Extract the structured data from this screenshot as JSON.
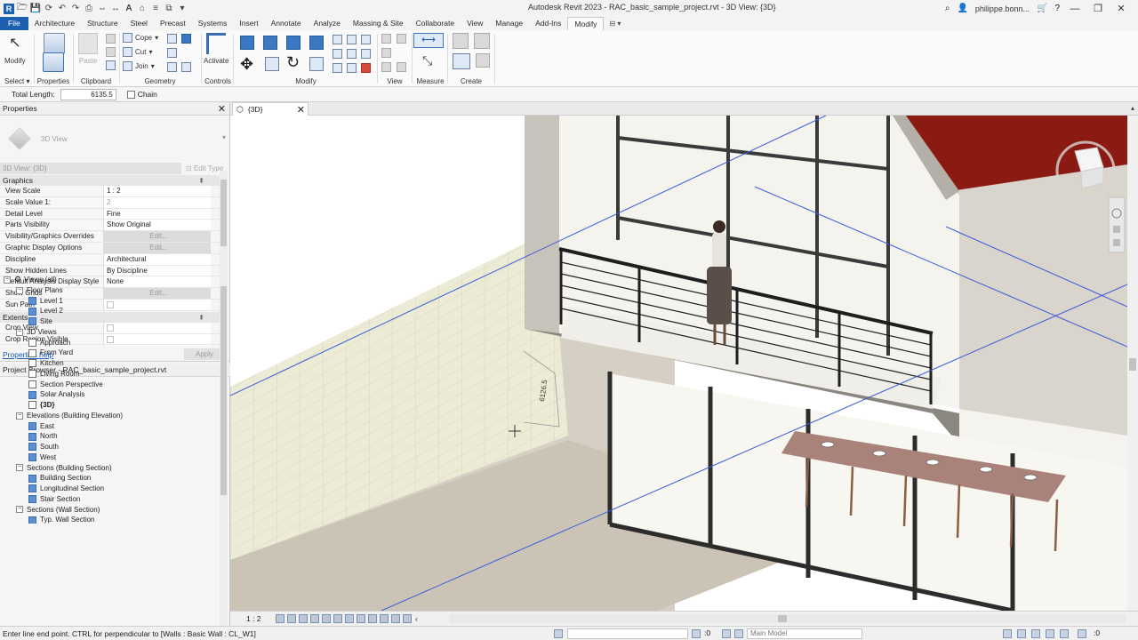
{
  "window": {
    "title": "Autodesk Revit 2023 - RAC_basic_sample_project.rvt - 3D View: {3D}",
    "user": "philippe.bonn...",
    "controls": [
      "—",
      "❐",
      "✕"
    ]
  },
  "ribbon": {
    "tabs": [
      "File",
      "Architecture",
      "Structure",
      "Steel",
      "Precast",
      "Systems",
      "Insert",
      "Annotate",
      "Analyze",
      "Massing & Site",
      "Collaborate",
      "View",
      "Manage",
      "Add-Ins",
      "Modify"
    ],
    "active_tab": "Modify",
    "groups": {
      "select": "Select",
      "select_arrow": "▾",
      "properties": "Properties",
      "clipboard": "Clipboard",
      "geometry": "Geometry",
      "controls": "Controls",
      "modify": "Modify",
      "view": "View",
      "measure": "Measure",
      "create": "Create"
    },
    "buttons": {
      "modify": "Modify",
      "paste": "Paste",
      "cope": "Cope",
      "cut": "Cut",
      "join": "Join",
      "activate": "Activate"
    }
  },
  "options_bar": {
    "total_length_label": "Total Length:",
    "total_length_value": "6135.5",
    "chain_label": "Chain"
  },
  "properties": {
    "title": "Properties",
    "type_name": "3D View",
    "instance_selector": "3D View: {3D}",
    "edit_type": "Edit Type",
    "sections": [
      {
        "name": "Graphics",
        "rows": [
          {
            "name": "View Scale",
            "value": "1 : 2"
          },
          {
            "name": "Scale Value    1:",
            "value": "2",
            "dim": true
          },
          {
            "name": "Detail Level",
            "value": "Fine"
          },
          {
            "name": "Parts Visibility",
            "value": "Show Original"
          },
          {
            "name": "Visibility/Graphics Overrides",
            "value": "Edit...",
            "button": true
          },
          {
            "name": "Graphic Display Options",
            "value": "Edit...",
            "button": true
          },
          {
            "name": "Discipline",
            "value": "Architectural"
          },
          {
            "name": "Show Hidden Lines",
            "value": "By Discipline"
          },
          {
            "name": "Default Analysis Display Style",
            "value": "None"
          },
          {
            "name": "Show Grids",
            "value": "Edit...",
            "button": true
          },
          {
            "name": "Sun Path",
            "value": "",
            "checkbox": true
          }
        ]
      },
      {
        "name": "Extents",
        "rows": [
          {
            "name": "Crop View",
            "value": "",
            "checkbox": true
          },
          {
            "name": "Crop Region Visible",
            "value": "",
            "checkbox": true
          },
          {
            "name": "Annotation Crop",
            "value": "",
            "checkbox": true
          }
        ]
      }
    ],
    "help_link": "Properties help",
    "apply": "Apply"
  },
  "project_browser": {
    "title": "Project Browser - RAC_basic_sample_project.rvt",
    "nodes": [
      {
        "label": "Views (all)",
        "level": 0,
        "type": "root"
      },
      {
        "label": "Floor Plans",
        "level": 1,
        "type": "group"
      },
      {
        "label": "Level 1",
        "level": 2,
        "type": "view",
        "sel": true
      },
      {
        "label": "Level 2",
        "level": 2,
        "type": "view",
        "sel": true
      },
      {
        "label": "Site",
        "level": 2,
        "type": "view",
        "sel": true
      },
      {
        "label": "3D Views",
        "level": 1,
        "type": "group"
      },
      {
        "label": "Approach",
        "level": 2,
        "type": "view"
      },
      {
        "label": "From Yard",
        "level": 2,
        "type": "view"
      },
      {
        "label": "Kitchen",
        "level": 2,
        "type": "view"
      },
      {
        "label": "Living Room",
        "level": 2,
        "type": "view"
      },
      {
        "label": "Section Perspective",
        "level": 2,
        "type": "view"
      },
      {
        "label": "Solar Analysis",
        "level": 2,
        "type": "view",
        "sel": true
      },
      {
        "label": "{3D}",
        "level": 2,
        "type": "view",
        "bold": true
      },
      {
        "label": "Elevations (Building Elevation)",
        "level": 1,
        "type": "group"
      },
      {
        "label": "East",
        "level": 2,
        "type": "view",
        "sel": true
      },
      {
        "label": "North",
        "level": 2,
        "type": "view",
        "sel": true
      },
      {
        "label": "South",
        "level": 2,
        "type": "view",
        "sel": true
      },
      {
        "label": "West",
        "level": 2,
        "type": "view",
        "sel": true
      },
      {
        "label": "Sections (Building Section)",
        "level": 1,
        "type": "group"
      },
      {
        "label": "Building Section",
        "level": 2,
        "type": "view",
        "sel": true
      },
      {
        "label": "Longitudinal Section",
        "level": 2,
        "type": "view",
        "sel": true
      },
      {
        "label": "Stair Section",
        "level": 2,
        "type": "view",
        "sel": true
      },
      {
        "label": "Sections (Wall Section)",
        "level": 1,
        "type": "group"
      },
      {
        "label": "Typ. Wall Section",
        "level": 2,
        "type": "view",
        "sel": true
      }
    ]
  },
  "document": {
    "tab_label": "{3D}",
    "dimension_value": "6126.5"
  },
  "view_bar": {
    "scale": "1 : 2"
  },
  "status": {
    "message": "Enter line end point.  CTRL for perpendicular to [Walls : Basic Wall : CL_W1]",
    "value": ":0",
    "workset": "Main Model"
  },
  "colors": {
    "file_tab": "#1f5fb0",
    "roof": "#8b1a13",
    "selection_line": "#3a5bd9"
  }
}
